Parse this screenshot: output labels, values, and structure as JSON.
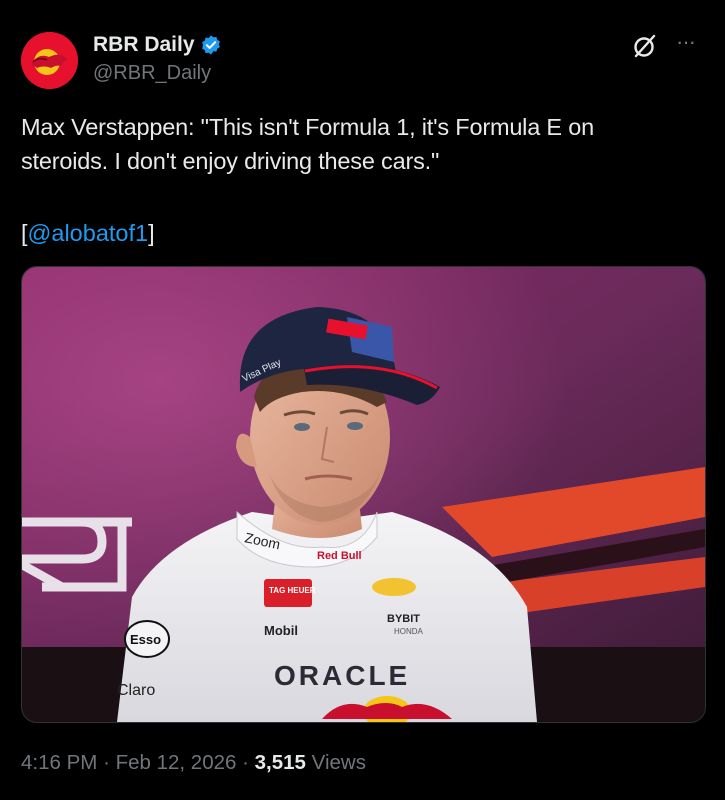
{
  "author": {
    "name": "RBR Daily",
    "handle": "@RBR_Daily",
    "verified": true,
    "avatar_icon": "red-bull-logo-icon",
    "brand_color": "#e8112d"
  },
  "tweet": {
    "text": "Max Verstappen: \"This isn't Formula 1, it's Formula E on\nsteroids. I don't enjoy driving these cars.\"",
    "credit_open": "[",
    "credit_handle": "@alobatof1",
    "credit_close": "]"
  },
  "media": {
    "icon": "photo-press-conference",
    "brand_text": {
      "cap_left": "Visa Play",
      "suit_collar": "Zoom",
      "suit_sponsor_1": "Red Bull",
      "tag_heuer": "TAG HEUER",
      "mobil": "Mobil",
      "bybit": "BYBIT",
      "honda": "HONDA",
      "esso": "Esso",
      "claro": "Claro",
      "oracle": "ORACLE"
    }
  },
  "meta": {
    "time": "4:16 PM",
    "sep1": "·",
    "date": "Feb 12, 2026",
    "sep2": "·",
    "views_count": "3,515",
    "views_label": "Views"
  },
  "colors": {
    "link": "#1d9bf0",
    "muted": "#71767b",
    "text": "#e7e9ea",
    "verified": "#1d9bf0"
  }
}
